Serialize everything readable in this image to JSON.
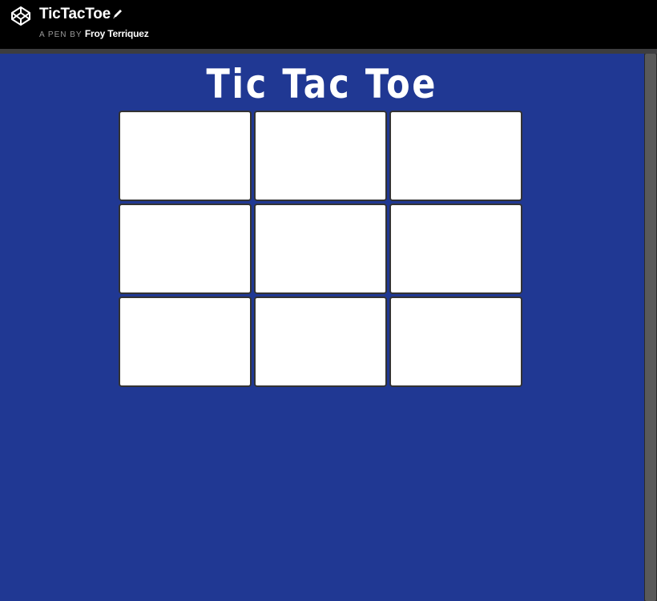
{
  "header": {
    "pen_title": "TicTacToe",
    "byline_prefix": "A PEN BY",
    "author": "Froy Terriquez",
    "logo_icon": "codepen-logo-icon",
    "edit_icon": "pencil-icon"
  },
  "game": {
    "title": "Tic Tac Toe",
    "background_color": "#203893",
    "cell_color": "#ffffff",
    "cells": [
      "",
      "",
      "",
      "",
      "",
      "",
      "",
      "",
      ""
    ]
  }
}
